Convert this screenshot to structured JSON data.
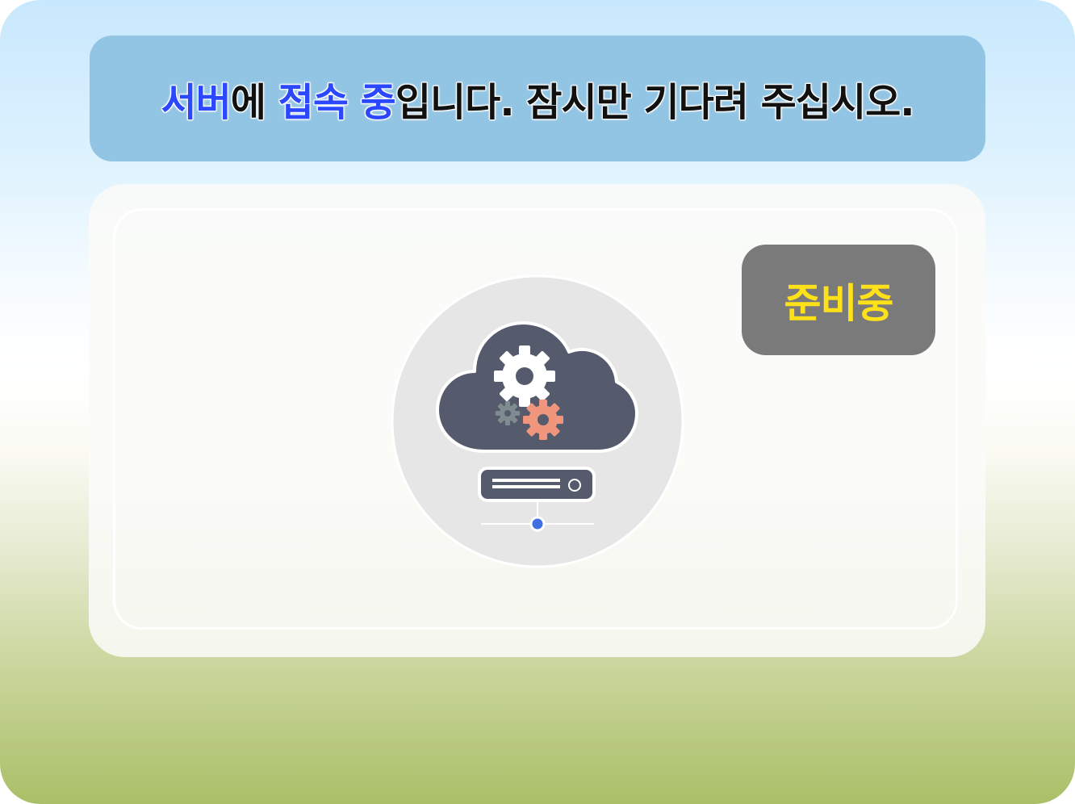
{
  "banner": {
    "part1": "서버",
    "part2": "에 ",
    "part3": "접속 중",
    "part4": "입니다. 잠시만 기다려 주십시오."
  },
  "status": {
    "label": "준비중"
  },
  "illustration": {
    "icon": "cloud-server-settings-icon"
  },
  "colors": {
    "highlight": "#2b48ff",
    "banner_bg": "#92c5e3",
    "badge_bg": "#7a7a7a",
    "badge_text": "#ffe11a",
    "cloud": "#555a6c",
    "gear_main": "#ffffff",
    "gear_orange": "#f0967c",
    "gear_gray": "#7f8c8f",
    "dot": "#3f6fe0"
  }
}
